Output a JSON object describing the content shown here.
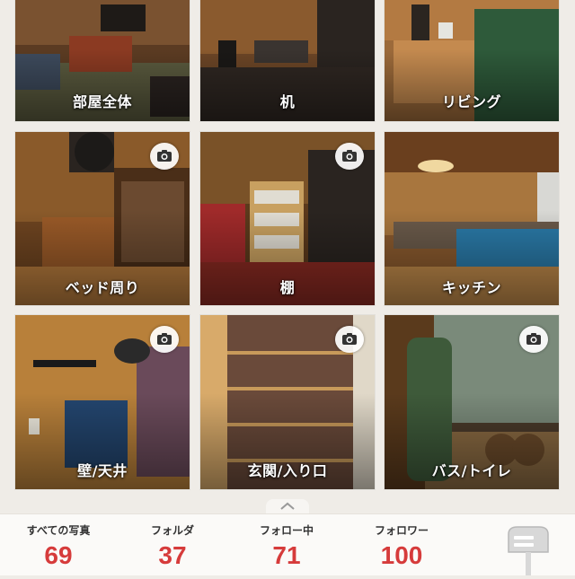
{
  "folders": [
    {
      "label": "部屋全体",
      "has_camera": false
    },
    {
      "label": "机",
      "has_camera": false
    },
    {
      "label": "リビング",
      "has_camera": false
    },
    {
      "label": "ベッド周り",
      "has_camera": true
    },
    {
      "label": "棚",
      "has_camera": true
    },
    {
      "label": "キッチン",
      "has_camera": false
    },
    {
      "label": "壁/天井",
      "has_camera": true
    },
    {
      "label": "玄関/入り口",
      "has_camera": true
    },
    {
      "label": "バス/トイレ",
      "has_camera": true
    }
  ],
  "stats": {
    "photos_label": "すべての写真",
    "photos_value": "69",
    "folders_label": "フォルダ",
    "folders_value": "37",
    "following_label": "フォロー中",
    "following_value": "71",
    "followers_label": "フォロワー",
    "followers_value": "100"
  },
  "colors": {
    "accent": "#d63b3b",
    "background": "#efece7"
  },
  "icons": {
    "camera": "camera-icon",
    "pull_tab": "chevron-up-icon",
    "mailbox": "mailbox-icon"
  }
}
